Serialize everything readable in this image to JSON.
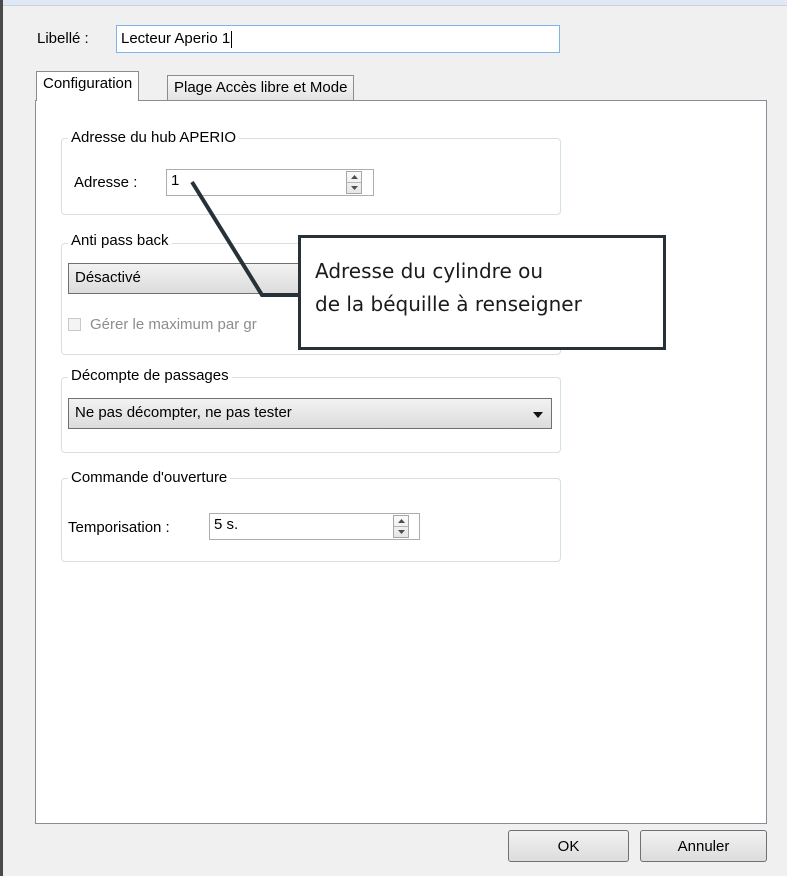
{
  "form": {
    "libelle_label": "Libellé :",
    "libelle_value": "Lecteur Aperio 1"
  },
  "tabs": [
    {
      "label": "Configuration",
      "active": true
    },
    {
      "label": "Plage Accès libre et Mode",
      "active": false
    }
  ],
  "hub_group": {
    "title": "Adresse du hub APERIO",
    "address_label": "Adresse :",
    "address_value": "1"
  },
  "antipass_group": {
    "title": "Anti pass back",
    "selected": "Désactivé",
    "checkbox_label": "Gérer le maximum par gr",
    "checkbox_checked": false
  },
  "decompte_group": {
    "title": "Décompte de passages",
    "selected": "Ne pas décompter, ne pas tester"
  },
  "commande_group": {
    "title": "Commande d'ouverture",
    "temporisation_label": "Temporisation :",
    "temporisation_value": "5 s."
  },
  "buttons": {
    "ok": "OK",
    "cancel": "Annuler"
  },
  "callout": {
    "line1": "Adresse du cylindre ou",
    "line2": "de la béquille à renseigner",
    "border_color": "#263238"
  }
}
